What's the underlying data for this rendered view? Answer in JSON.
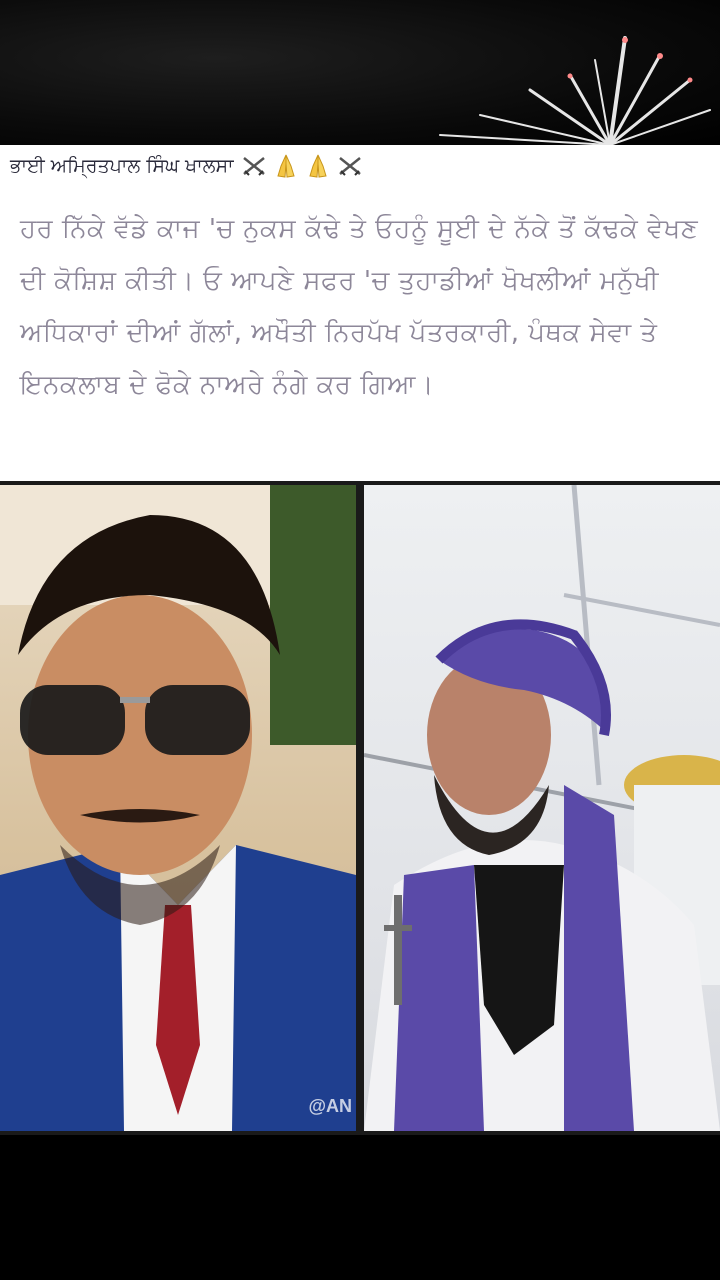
{
  "post": {
    "header_text": "ਭਾਈ ਅਮ੍ਰਿਤਪਾਲ ਸਿੰਘ ਖਾਲਸਾ",
    "header_icons": [
      "crossed-swords-icon",
      "folded-hands-icon",
      "folded-hands-icon",
      "crossed-swords-icon"
    ],
    "quote": "ਹਰ ਨਿੱਕੇ ਵੱਡੇ ਕਾਜ 'ਚ ਨੁਕਸ ਕੱਢੇ ਤੇ ਓਹਨੂੰ ਸੂਈ ਦੇ ਨੱਕੇ ਤੋਂ ਕੱਢਕੇ ਵੇਖਣ ਦੀ ਕੋਸ਼ਿਸ਼ ਕੀਤੀ। ਓ ਆਪਣੇ ਸਫਰ 'ਚ ਤੁਹਾਡੀਆਂ ਖੋਖਲੀਆਂ ਮਨੁੱਖੀ ਅਧਿਕਾਰਾਂ ਦੀਆਂ ਗੱਲਾਂ, ਅਖੌਤੀ ਨਿਰਪੱਖ ਪੱਤਰਕਾਰੀ, ਪੰਥਕ ਸੇਵਾ ਤੇ ਇਨਕਲਾਬ ਦੇ ਫੋਕੇ ਨਾਅਰੇ ਨੰਗੇ ਕਰ ਗਿਆ।",
    "watermark": "@AN"
  },
  "colors": {
    "quote_text": "#8d8799",
    "header_text": "#2a2a3a",
    "turban": "#5a4aa8",
    "suit": "#1f3f8f",
    "tie": "#a31f2a"
  }
}
